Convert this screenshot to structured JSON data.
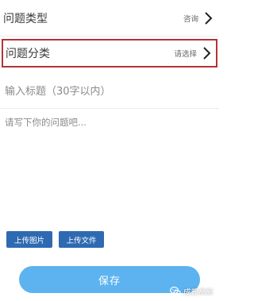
{
  "form": {
    "type_row": {
      "label": "问题类型",
      "value": "咨询"
    },
    "category_row": {
      "label": "问题分类",
      "value": "请选择"
    },
    "title_input": {
      "placeholder": "输入标题（30字以内）"
    },
    "body_input": {
      "placeholder": "请写下你的问题吧..."
    }
  },
  "actions": {
    "upload_image_label": "上传图片",
    "upload_file_label": "上传文件",
    "save_label": "保存"
  },
  "watermark": {
    "text": "成都高新"
  },
  "colors": {
    "upload_button": "#2e6ab2",
    "save_button": "#5cb3f0",
    "highlight_border": "#b3343a"
  },
  "icons": {
    "row_arrow": "chevron-right-icon",
    "watermark": "wechat-icon"
  }
}
